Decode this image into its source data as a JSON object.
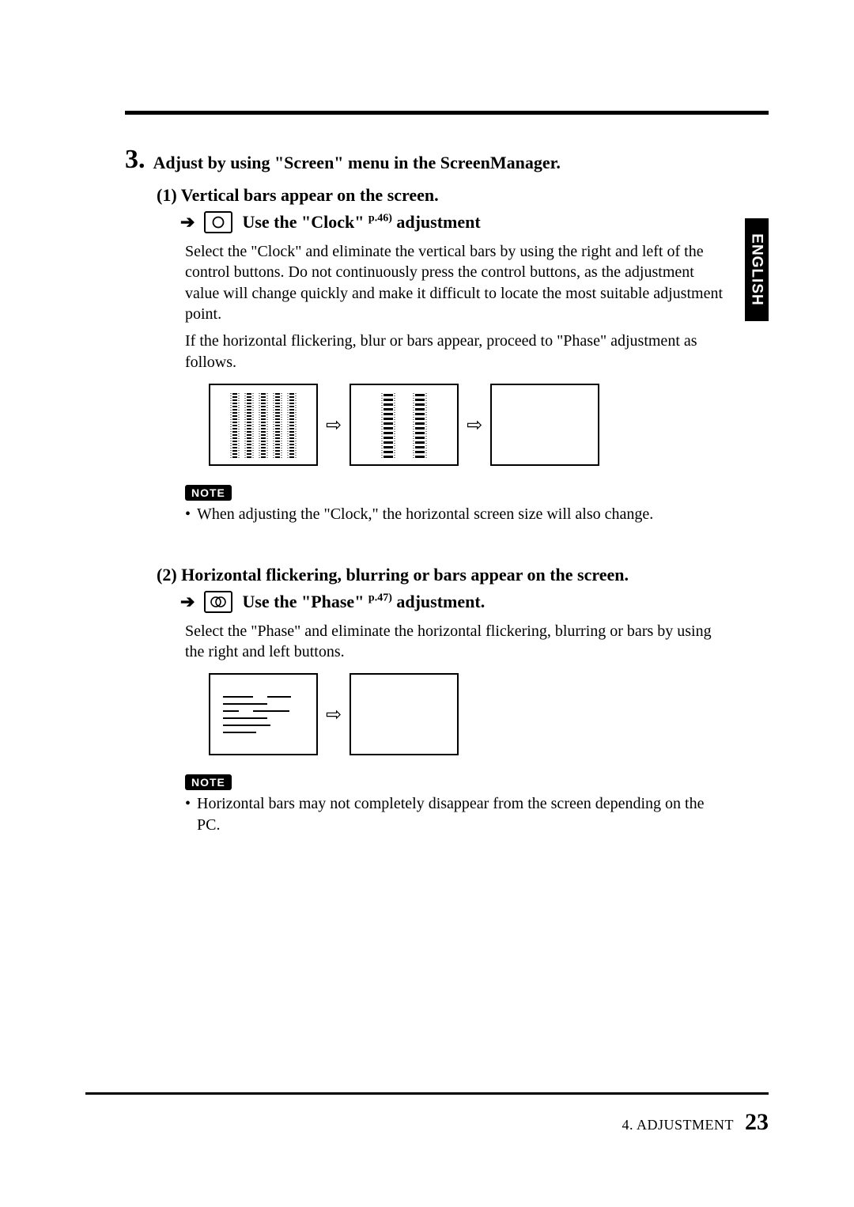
{
  "language_tab": "ENGLISH",
  "step": {
    "number": "3.",
    "title": "Adjust by using \"Screen\" menu in the ScreenManager."
  },
  "section1": {
    "heading": "(1)  Vertical bars appear on the screen.",
    "action_prefix": "Use the \"Clock\" ",
    "page_ref": "p.46)",
    "action_suffix": " adjustment",
    "arrow": "➔",
    "flow_arrow": "⇨",
    "body1": "Select the \"Clock\" and eliminate the vertical bars by using the right and left of the control buttons.  Do not continuously press the control buttons, as the adjustment value will change quickly and make it difficult to locate the most suitable adjustment point.",
    "body2": "If the horizontal flickering, blur or bars appear, proceed to \"Phase\" adjustment as follows.",
    "note_label": "NOTE",
    "note_bullet": "When adjusting the \"Clock,\" the horizontal screen size will also change."
  },
  "section2": {
    "heading": "(2)  Horizontal flickering, blurring or bars appear on the screen.",
    "action_prefix": "Use the \"Phase\" ",
    "page_ref": "p.47)",
    "action_suffix": " adjustment.",
    "arrow": "➔",
    "flow_arrow": "⇨",
    "body": "Select the \"Phase\" and eliminate the horizontal flickering, blurring or bars by using the right and left buttons.",
    "note_label": "NOTE",
    "note_bullet": "Horizontal bars may not completely disappear from the screen depending on the PC."
  },
  "footer": {
    "chapter": "4. ADJUSTMENT",
    "page": "23"
  }
}
